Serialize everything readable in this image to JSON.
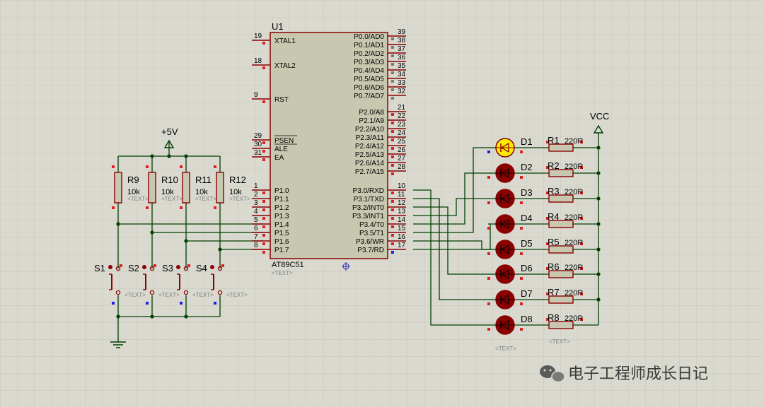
{
  "mcu": {
    "ref": "U1",
    "part": "AT89C51",
    "placeholder": "<TEXT>",
    "left_pins": [
      {
        "num": "19",
        "label": "XTAL1"
      },
      {
        "num": "18",
        "label": "XTAL2"
      },
      {
        "num": "9",
        "label": "RST"
      },
      {
        "num": "29",
        "label": "PSEN"
      },
      {
        "num": "30",
        "label": "ALE"
      },
      {
        "num": "31",
        "label": "EA"
      },
      {
        "num": "1",
        "label": "P1.0"
      },
      {
        "num": "2",
        "label": "P1.1"
      },
      {
        "num": "3",
        "label": "P1.2"
      },
      {
        "num": "4",
        "label": "P1.3"
      },
      {
        "num": "5",
        "label": "P1.4"
      },
      {
        "num": "6",
        "label": "P1.5"
      },
      {
        "num": "7",
        "label": "P1.6"
      },
      {
        "num": "8",
        "label": "P1.7"
      }
    ],
    "right_pins": [
      {
        "num": "39",
        "label": "P0.0/AD0"
      },
      {
        "num": "38",
        "label": "P0.1/AD1"
      },
      {
        "num": "37",
        "label": "P0.2/AD2"
      },
      {
        "num": "36",
        "label": "P0.3/AD3"
      },
      {
        "num": "35",
        "label": "P0.4/AD4"
      },
      {
        "num": "34",
        "label": "P0.5/AD5"
      },
      {
        "num": "33",
        "label": "P0.6/AD6"
      },
      {
        "num": "32",
        "label": "P0.7/AD7"
      },
      {
        "num": "21",
        "label": "P2.0/A8"
      },
      {
        "num": "22",
        "label": "P2.1/A9"
      },
      {
        "num": "23",
        "label": "P2.2/A10"
      },
      {
        "num": "24",
        "label": "P2.3/A11"
      },
      {
        "num": "25",
        "label": "P2.4/A12"
      },
      {
        "num": "26",
        "label": "P2.5/A13"
      },
      {
        "num": "27",
        "label": "P2.6/A14"
      },
      {
        "num": "28",
        "label": "P2.7/A15"
      },
      {
        "num": "10",
        "label": "P3.0/RXD"
      },
      {
        "num": "11",
        "label": "P3.1/TXD"
      },
      {
        "num": "12",
        "label": "P3.2/INT0"
      },
      {
        "num": "13",
        "label": "P3.3/INT1"
      },
      {
        "num": "14",
        "label": "P3.4/T0"
      },
      {
        "num": "15",
        "label": "P3.5/T1"
      },
      {
        "num": "16",
        "label": "P3.6/WR"
      },
      {
        "num": "17",
        "label": "P3.7/RD"
      }
    ]
  },
  "power": {
    "vcc": "VCC",
    "plus5": "+5V"
  },
  "pullups": [
    {
      "ref": "R9",
      "value": "10k",
      "placeholder": "<TEXT>"
    },
    {
      "ref": "R10",
      "value": "10k",
      "placeholder": "<TEXT>"
    },
    {
      "ref": "R11",
      "value": "10k",
      "placeholder": "<TEXT>"
    },
    {
      "ref": "R12",
      "value": "10k",
      "placeholder": "<TEXT>"
    }
  ],
  "switches": [
    {
      "ref": "S1",
      "placeholder": "<TEXT>"
    },
    {
      "ref": "S2",
      "placeholder": "<TEXT>"
    },
    {
      "ref": "S3",
      "placeholder": "<TEXT>"
    },
    {
      "ref": "S4",
      "placeholder": "<TEXT>"
    }
  ],
  "leds": [
    {
      "ref": "D1",
      "resistor": "R1",
      "value": "220R",
      "lit": true
    },
    {
      "ref": "D2",
      "resistor": "R2",
      "value": "220R",
      "lit": false
    },
    {
      "ref": "D3",
      "resistor": "R3",
      "value": "220R",
      "lit": false
    },
    {
      "ref": "D4",
      "resistor": "R4",
      "value": "220R",
      "lit": false
    },
    {
      "ref": "D5",
      "resistor": "R5",
      "value": "220R",
      "lit": false
    },
    {
      "ref": "D6",
      "resistor": "R6",
      "value": "220R",
      "lit": false
    },
    {
      "ref": "D7",
      "resistor": "R7",
      "value": "220R",
      "lit": false
    },
    {
      "ref": "D8",
      "resistor": "R8",
      "value": "220R",
      "lit": false
    }
  ],
  "led_placeholder": "<TEXT>",
  "res_placeholder": "<TEXT>",
  "watermark": "电子工程师成长日记",
  "colors": {
    "background": "#d9d9d0",
    "grid": "#c6c6bc",
    "wire": "#004000",
    "component": "#8b0000",
    "chip_fill": "#c8c8b0",
    "resistor_fill": "#c8c8b0",
    "pin_red": "#e02020",
    "pin_blue": "#2020e0",
    "led_off": "#8b0000",
    "led_on": "#ffee00"
  }
}
